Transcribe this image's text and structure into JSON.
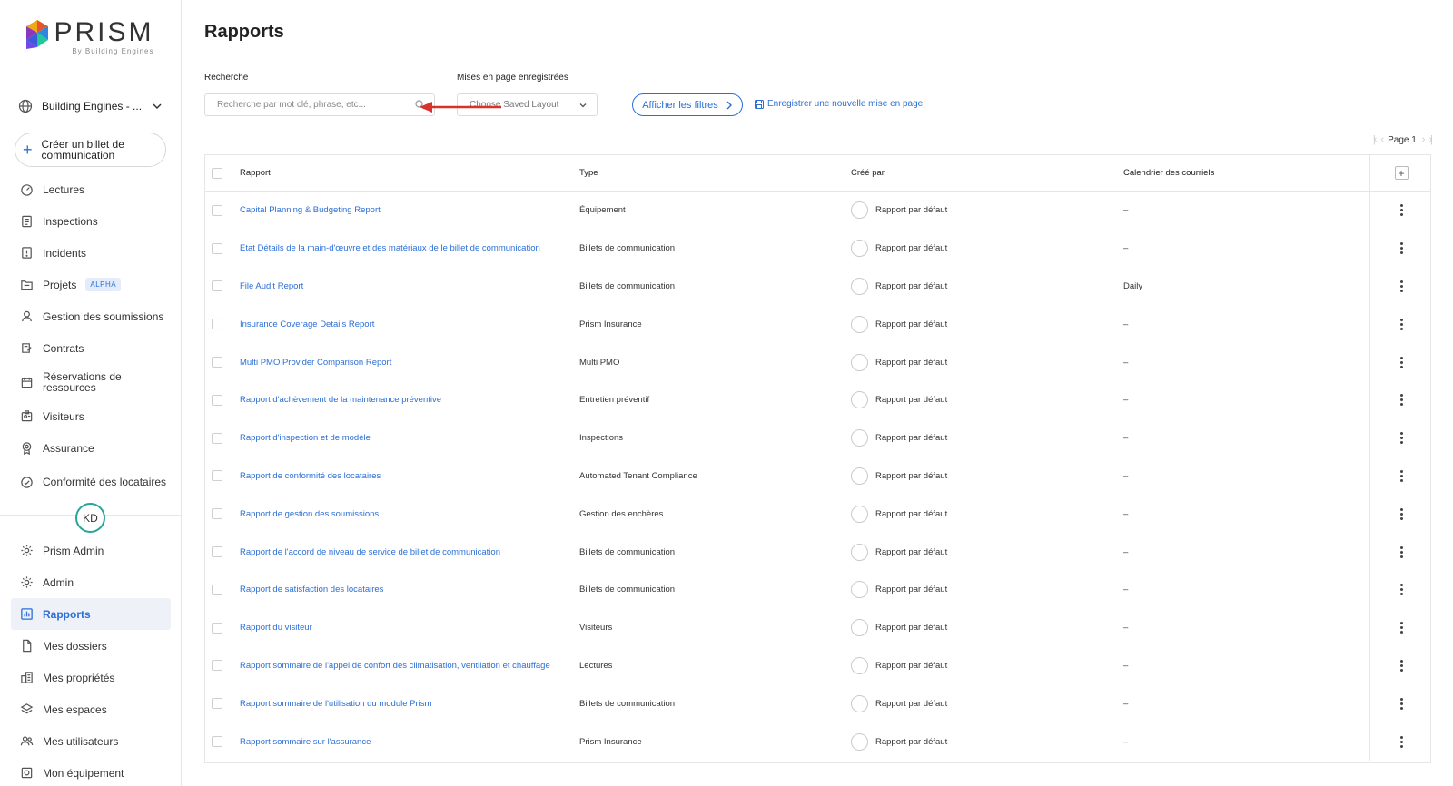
{
  "brand": {
    "name": "PRISM",
    "tagline": "By Building Engines"
  },
  "org": {
    "label": "Building Engines - ..."
  },
  "create_button": {
    "label": "Créer un billet de communication"
  },
  "nav_top": [
    {
      "label": "Lectures",
      "icon": "gauge-icon"
    },
    {
      "label": "Inspections",
      "icon": "clipboard-icon"
    },
    {
      "label": "Incidents",
      "icon": "alert-icon"
    },
    {
      "label": "Projets",
      "icon": "folder-icon",
      "badge": "ALPHA"
    },
    {
      "label": "Gestion des soumissions",
      "icon": "person-icon"
    },
    {
      "label": "Contrats",
      "icon": "contract-icon"
    },
    {
      "label": "Réservations de ressources",
      "icon": "calendar-icon"
    },
    {
      "label": "Visiteurs",
      "icon": "badge-icon"
    },
    {
      "label": "Assurance",
      "icon": "award-icon"
    },
    {
      "label": "Conformité des locataires",
      "icon": "check-circle-icon"
    }
  ],
  "user": {
    "initials": "KD"
  },
  "nav_bottom": [
    {
      "label": "Prism Admin",
      "icon": "gear-icon"
    },
    {
      "label": "Admin",
      "icon": "gear-icon"
    },
    {
      "label": "Rapports",
      "icon": "chart-icon",
      "active": true
    },
    {
      "label": "Mes dossiers",
      "icon": "file-icon"
    },
    {
      "label": "Mes propriétés",
      "icon": "building-icon"
    },
    {
      "label": "Mes espaces",
      "icon": "layers-icon"
    },
    {
      "label": "Mes utilisateurs",
      "icon": "users-icon"
    },
    {
      "label": "Mon équipement",
      "icon": "equipment-icon"
    }
  ],
  "page": {
    "title": "Rapports",
    "search_label": "Recherche",
    "search_placeholder": "Recherche par mot clé, phrase, etc...",
    "layouts_label": "Mises en page enregistrées",
    "layout_select": "Choose Saved Layout",
    "filters_button": "Afficher les filtres",
    "save_layout_link": "Enregistrer une nouvelle mise en page",
    "pager": "Page 1"
  },
  "table": {
    "headers": {
      "name": "Rapport",
      "type": "Type",
      "by": "Créé par",
      "calendar": "Calendrier des courriels"
    },
    "rows": [
      {
        "name": "Capital Planning & Budgeting Report",
        "type": "Équipement",
        "by": "Rapport par défaut",
        "calendar": "–"
      },
      {
        "name": "Etat Détails de la main-d'œuvre et des matériaux de le billet de communication",
        "type": "Billets de communication",
        "by": "Rapport par défaut",
        "calendar": "–"
      },
      {
        "name": "File Audit Report",
        "type": "Billets de communication",
        "by": "Rapport par défaut",
        "calendar": "Daily"
      },
      {
        "name": "Insurance Coverage Details Report",
        "type": "Prism Insurance",
        "by": "Rapport par défaut",
        "calendar": "–"
      },
      {
        "name": "Multi PMO Provider Comparison Report",
        "type": "Multi PMO",
        "by": "Rapport par défaut",
        "calendar": "–"
      },
      {
        "name": "Rapport d'achèvement de la maintenance préventive",
        "type": "Entretien préventif",
        "by": "Rapport par défaut",
        "calendar": "–"
      },
      {
        "name": "Rapport d'inspection et de modèle",
        "type": "Inspections",
        "by": "Rapport par défaut",
        "calendar": "–"
      },
      {
        "name": "Rapport de conformité des locataires",
        "type": "Automated Tenant Compliance",
        "by": "Rapport par défaut",
        "calendar": "–"
      },
      {
        "name": "Rapport de gestion des soumissions",
        "type": "Gestion des enchères",
        "by": "Rapport par défaut",
        "calendar": "–"
      },
      {
        "name": "Rapport de l'accord de niveau de service de billet de communication",
        "type": "Billets de communication",
        "by": "Rapport par défaut",
        "calendar": "–"
      },
      {
        "name": "Rapport de satisfaction des locataires",
        "type": "Billets de communication",
        "by": "Rapport par défaut",
        "calendar": "–"
      },
      {
        "name": "Rapport du visiteur",
        "type": "Visiteurs",
        "by": "Rapport par défaut",
        "calendar": "–"
      },
      {
        "name": "Rapport sommaire de l'appel de confort des climatisation, ventilation et chauffage",
        "type": "Lectures",
        "by": "Rapport par défaut",
        "calendar": "–"
      },
      {
        "name": "Rapport sommaire de l'utilisation du module Prism",
        "type": "Billets de communication",
        "by": "Rapport par défaut",
        "calendar": "–"
      },
      {
        "name": "Rapport sommaire sur l'assurance",
        "type": "Prism Insurance",
        "by": "Rapport par défaut",
        "calendar": "–"
      }
    ]
  },
  "colors": {
    "accent": "#2b6fd6",
    "arrow": "#d9312b",
    "avatar_ring": "#27a39a"
  }
}
